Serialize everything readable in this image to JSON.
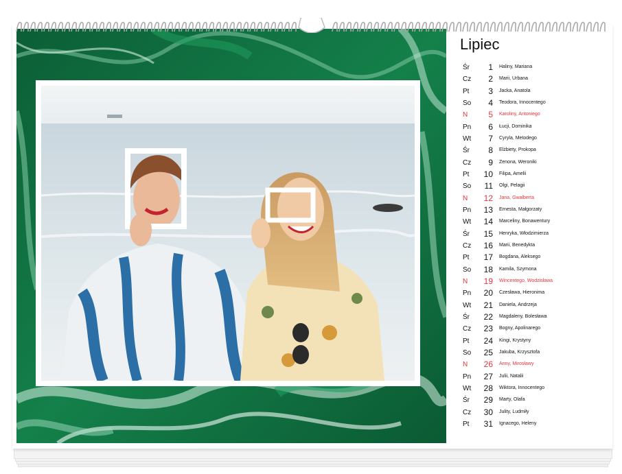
{
  "calendar": {
    "month": "Lipiec",
    "days": [
      {
        "abbr": "Śr",
        "num": "1",
        "names": "Haliny, Mariana",
        "holiday": false
      },
      {
        "abbr": "Cz",
        "num": "2",
        "names": "Marii, Urbana",
        "holiday": false
      },
      {
        "abbr": "Pt",
        "num": "3",
        "names": "Jacka, Anatola",
        "holiday": false
      },
      {
        "abbr": "So",
        "num": "4",
        "names": "Teodora, Innocentego",
        "holiday": false
      },
      {
        "abbr": "N",
        "num": "5",
        "names": "Karoliny, Antoniego",
        "holiday": true
      },
      {
        "abbr": "Pn",
        "num": "6",
        "names": "Łucji, Dominika",
        "holiday": false
      },
      {
        "abbr": "Wt",
        "num": "7",
        "names": "Cyryla, Metodego",
        "holiday": false
      },
      {
        "abbr": "Śr",
        "num": "8",
        "names": "Elżbiety, Prokopa",
        "holiday": false
      },
      {
        "abbr": "Cz",
        "num": "9",
        "names": "Zenona, Weroniki",
        "holiday": false
      },
      {
        "abbr": "Pt",
        "num": "10",
        "names": "Filipa, Amelii",
        "holiday": false
      },
      {
        "abbr": "So",
        "num": "11",
        "names": "Olgi, Pelagii",
        "holiday": false
      },
      {
        "abbr": "N",
        "num": "12",
        "names": "Jana, Gwalberta",
        "holiday": true
      },
      {
        "abbr": "Pn",
        "num": "13",
        "names": "Ernesta, Małgorzaty",
        "holiday": false
      },
      {
        "abbr": "Wt",
        "num": "14",
        "names": "Marceliny, Bonawentury",
        "holiday": false
      },
      {
        "abbr": "Śr",
        "num": "15",
        "names": "Henryka, Włodzimierza",
        "holiday": false
      },
      {
        "abbr": "Cz",
        "num": "16",
        "names": "Marii, Benedykta",
        "holiday": false
      },
      {
        "abbr": "Pt",
        "num": "17",
        "names": "Bogdana, Aleksego",
        "holiday": false
      },
      {
        "abbr": "So",
        "num": "18",
        "names": "Kamila, Szymona",
        "holiday": false
      },
      {
        "abbr": "N",
        "num": "19",
        "names": "Wincentego, Wodzisława",
        "holiday": true
      },
      {
        "abbr": "Pn",
        "num": "20",
        "names": "Czesława, Hieronima",
        "holiday": false
      },
      {
        "abbr": "Wt",
        "num": "21",
        "names": "Daniela, Andrzeja",
        "holiday": false
      },
      {
        "abbr": "Śr",
        "num": "22",
        "names": "Magdaleny, Bolesława",
        "holiday": false
      },
      {
        "abbr": "Cz",
        "num": "23",
        "names": "Bogny, Apolinarego",
        "holiday": false
      },
      {
        "abbr": "Pt",
        "num": "24",
        "names": "Kingi, Krystyny",
        "holiday": false
      },
      {
        "abbr": "So",
        "num": "25",
        "names": "Jakuba, Krzysztofa",
        "holiday": false
      },
      {
        "abbr": "N",
        "num": "26",
        "names": "Anny, Mirosławy",
        "holiday": true
      },
      {
        "abbr": "Pn",
        "num": "27",
        "names": "Julii, Natalii",
        "holiday": false
      },
      {
        "abbr": "Wt",
        "num": "28",
        "names": "Wiktora, Innocentego",
        "holiday": false
      },
      {
        "abbr": "Śr",
        "num": "29",
        "names": "Marty, Olafa",
        "holiday": false
      },
      {
        "abbr": "Cz",
        "num": "30",
        "names": "Julity, Ludmiły",
        "holiday": false
      },
      {
        "abbr": "Pt",
        "num": "31",
        "names": "Ignacego, Heleny",
        "holiday": false
      }
    ]
  },
  "colors": {
    "holiday": "#e5343e",
    "marble_green": "#0f6b3e",
    "text": "#111111"
  }
}
